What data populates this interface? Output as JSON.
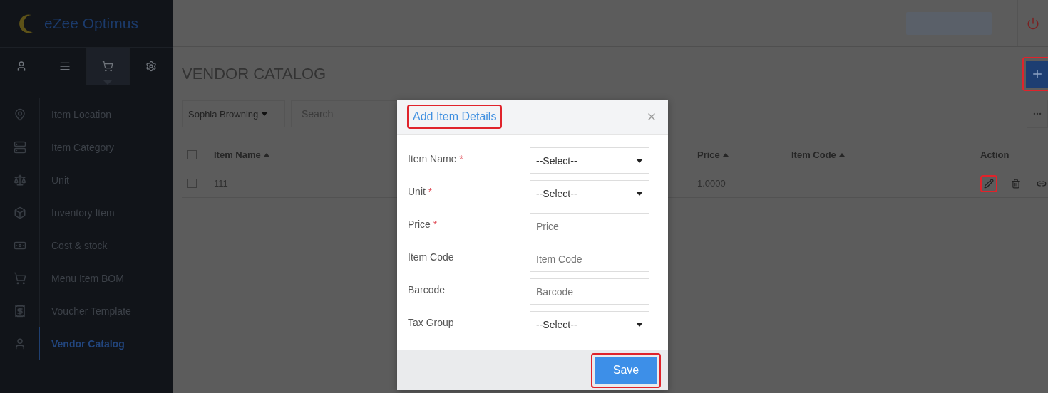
{
  "sidebar": {
    "logo_text": "eZee Optimus",
    "tabs": [
      {
        "selected": false
      },
      {
        "selected": false
      },
      {
        "selected": true
      },
      {
        "selected": false
      }
    ],
    "items": [
      {
        "label": "Item Location",
        "selected": false
      },
      {
        "label": "Item Category",
        "selected": false
      },
      {
        "label": "Unit",
        "selected": false
      },
      {
        "label": "Inventory Item",
        "selected": false
      },
      {
        "label": "Cost & stock",
        "selected": false
      },
      {
        "label": "Menu Item BOM",
        "selected": false
      },
      {
        "label": "Voucher Template",
        "selected": false
      },
      {
        "label": "Vendor Catalog",
        "selected": true
      }
    ]
  },
  "page": {
    "title": "VENDOR CATALOG",
    "add_highlighted": true
  },
  "filter": {
    "vendor": "Sophia Browning",
    "search_placeholder": "Search"
  },
  "table": {
    "all_checked": false,
    "columns": [
      {
        "label": "Item Name",
        "sortable": true
      },
      {
        "label": "Price",
        "sortable": true
      },
      {
        "label": "Item Code",
        "sortable": true
      },
      {
        "label": "Action",
        "sortable": false
      }
    ],
    "rows": [
      {
        "checked": false,
        "item_name": "111",
        "price": "1.0000",
        "edit_highlighted": true
      }
    ]
  },
  "dialog": {
    "title": "Add Item Details",
    "title_highlighted": true,
    "fields": [
      {
        "label": "Item Name",
        "required_mark": "*",
        "kind": "select",
        "value": "--Select--"
      },
      {
        "label": "Unit",
        "required_mark": "*",
        "kind": "select",
        "value": "--Select--"
      },
      {
        "label": "Price",
        "required_mark": "*",
        "kind": "input",
        "placeholder": "Price"
      },
      {
        "label": "Item Code",
        "kind": "input",
        "placeholder": "Item Code"
      },
      {
        "label": "Barcode",
        "kind": "input",
        "placeholder": "Barcode"
      },
      {
        "label": "Tax Group",
        "kind": "select",
        "value": "--Select--"
      }
    ],
    "save_label": "Save",
    "save_highlighted": true
  }
}
